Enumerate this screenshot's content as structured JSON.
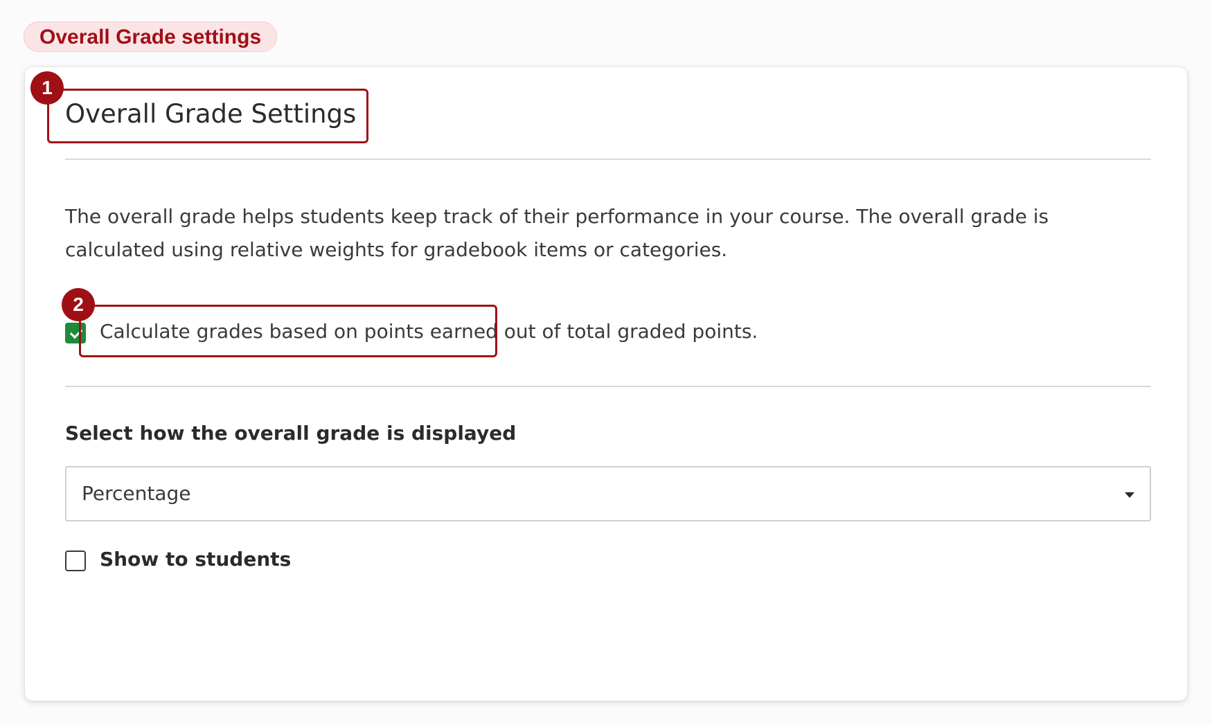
{
  "header_tag": "Overall Grade settings",
  "card": {
    "title": "Overall Grade Settings",
    "description": "The overall grade helps students keep track of their performance in your course. The overall grade is calculated using relative weights for gradebook items or categories.",
    "points_option": {
      "label": "Calculate grades based on points earned out of total graded points.",
      "checked": true
    },
    "display_section": {
      "label": "Select how the overall grade is displayed",
      "selected_value": "Percentage"
    },
    "show_to_students": {
      "label": "Show to students",
      "checked": false
    }
  },
  "callouts": {
    "one": "1",
    "two": "2"
  },
  "colors": {
    "accent": "#a00f16",
    "check_green": "#1e8a3a",
    "pill_background": "#fbe4e6"
  }
}
